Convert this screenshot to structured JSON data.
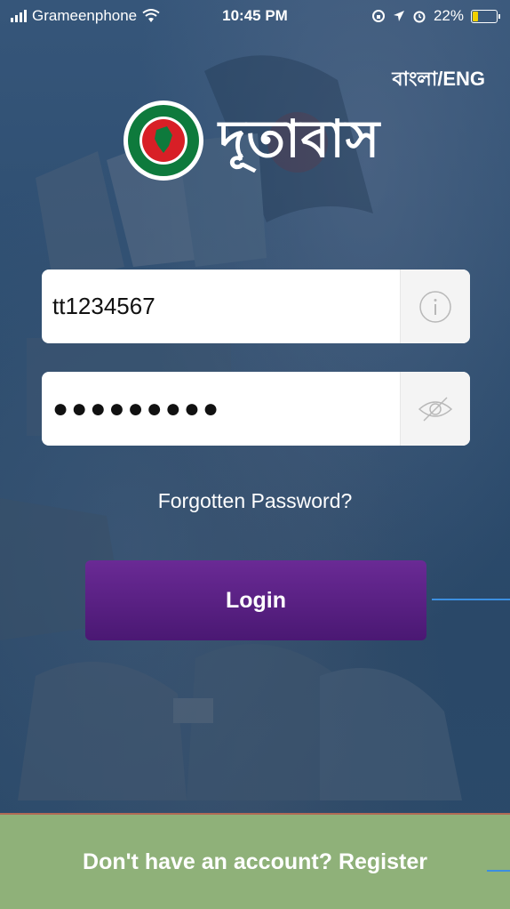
{
  "status_bar": {
    "carrier": "Grameenphone",
    "time": "10:45 PM",
    "battery": "22%",
    "battery_level": 0.22
  },
  "header": {
    "language_toggle": "বাংলা/ENG",
    "app_title": "দূতাবাস"
  },
  "form": {
    "username_value": "tt1234567",
    "password_mask": "●●●●●●●●●",
    "username_icon": "info-icon",
    "password_icon": "eye-slash-icon",
    "forgot_label": "Forgotten Password?",
    "login_label": "Login"
  },
  "footer": {
    "register_label": "Don't have an account? Register"
  },
  "colors": {
    "login_button": "#5a1f83",
    "footer": "#8fb179",
    "accent_line": "#3c8fe0"
  }
}
